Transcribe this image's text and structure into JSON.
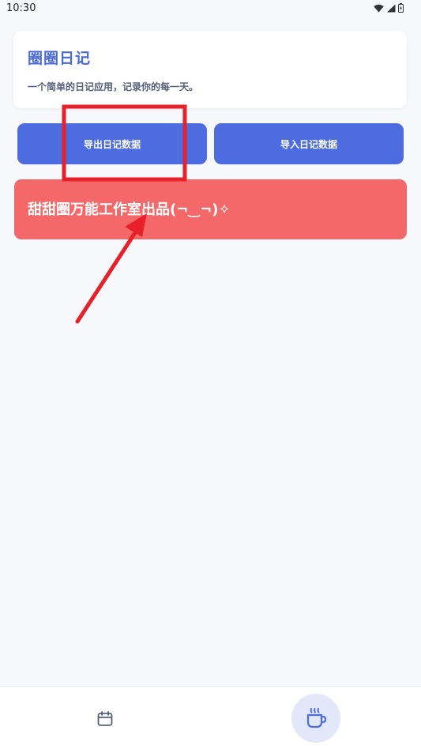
{
  "status_bar": {
    "time": "10:30",
    "icons": [
      "wifi-icon",
      "cell-signal-icon",
      "battery-icon"
    ]
  },
  "header": {
    "title": "圈圈日记",
    "subtitle": "一个简单的日记应用，记录你的每一天。"
  },
  "actions": {
    "export_label": "导出日记数据",
    "import_label": "导入日记数据"
  },
  "banner": {
    "text": "甜甜圈万能工作室出品(¬‿¬)✧"
  },
  "bottom_nav": {
    "items": [
      {
        "icon": "calendar-icon",
        "active": false
      },
      {
        "icon": "coffee-cup-icon",
        "active": true
      }
    ]
  },
  "colors": {
    "primary": "#4d6ce0",
    "title": "#4a6ad8",
    "banner": "#f5686a",
    "annotation": "#e8202a",
    "background": "#f7f8fb"
  }
}
